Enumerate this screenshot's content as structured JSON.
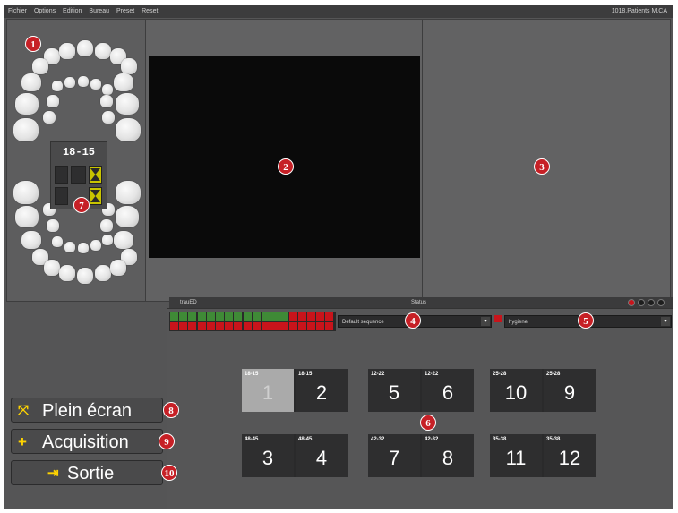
{
  "menu": [
    "Fichier",
    "Options",
    "Edition",
    "Bureau",
    "Preset",
    "Reset"
  ],
  "patient_info": "1018,Patients M.CA",
  "markers": [
    "1",
    "2",
    "3",
    "4",
    "5",
    "6",
    "7",
    "8",
    "9",
    "10"
  ],
  "selector": {
    "label": "18-15"
  },
  "status_panel": {
    "title": "trauED",
    "status_label": "Status",
    "sequence_dropdown": "Default sequence",
    "protocol_dropdown": "hygiene",
    "colors": {
      "green": "#3f8a36",
      "red": "#c8141b"
    }
  },
  "image_pairs": [
    [
      {
        "region": "18-15",
        "number": "1",
        "selected": true
      },
      {
        "region": "18-15",
        "number": "2"
      }
    ],
    [
      {
        "region": "12-22",
        "number": "5"
      },
      {
        "region": "12-22",
        "number": "6"
      }
    ],
    [
      {
        "region": "25-28",
        "number": "10"
      },
      {
        "region": "25-28",
        "number": "9"
      }
    ],
    [
      {
        "region": "48-45",
        "number": "3"
      },
      {
        "region": "48-45",
        "number": "4"
      }
    ],
    [
      {
        "region": "42-32",
        "number": "7"
      },
      {
        "region": "42-32",
        "number": "8"
      }
    ],
    [
      {
        "region": "35-38",
        "number": "11"
      },
      {
        "region": "35-38",
        "number": "12"
      }
    ]
  ],
  "buttons": {
    "fullscreen": "Plein écran",
    "acquisition": "Acquisition",
    "exit": "Sortie"
  },
  "icons": {
    "fullscreen": "expand-arrows-icon",
    "acquisition": "plus-icon",
    "exit": "door-exit-icon"
  }
}
